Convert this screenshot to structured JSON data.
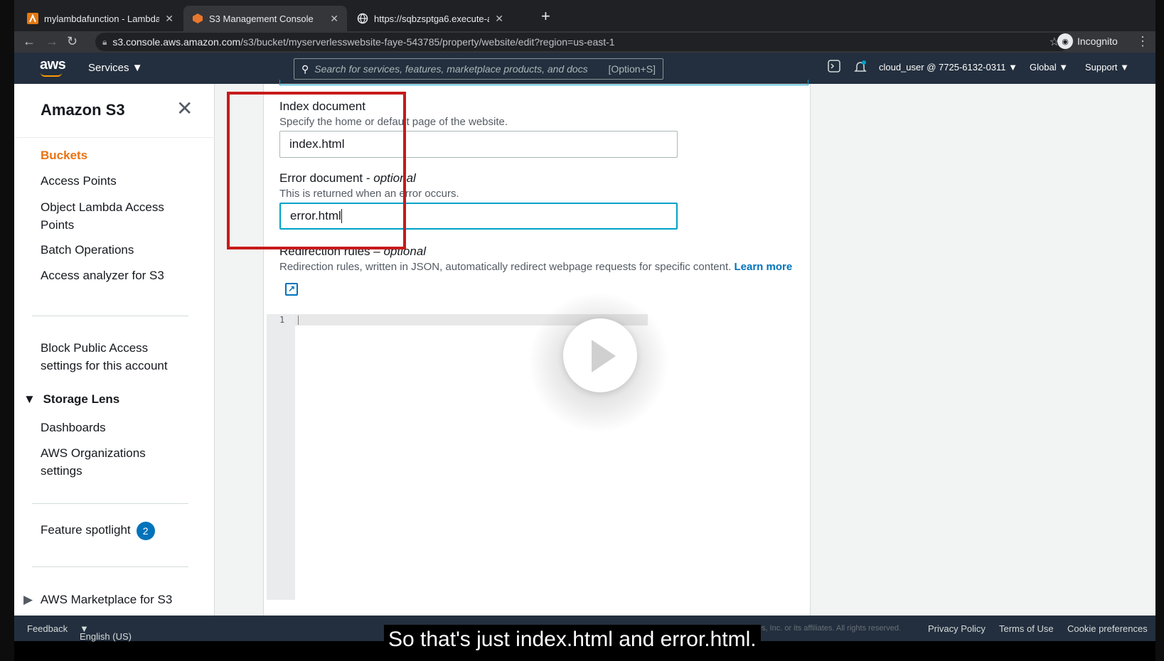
{
  "browser": {
    "tabs": [
      {
        "title": "mylambdafunction - Lambda",
        "icon": "lambda-icon",
        "active": false
      },
      {
        "title": "S3 Management Console",
        "icon": "s3-icon",
        "active": true
      },
      {
        "title": "https://sqbzsptga6.execute-a",
        "icon": "globe-icon",
        "active": false
      }
    ],
    "url_domain": "s3.console.aws.amazon.com",
    "url_path": "/s3/bucket/myserverlesswebsite-faye-543785/property/website/edit?region=us-east-1",
    "profile_label": "Incognito"
  },
  "aws_nav": {
    "logo": "aws",
    "services": "Services",
    "search_placeholder": "Search for services, features, marketplace products, and docs",
    "search_shortcut": "[Option+S]",
    "account": "cloud_user @ 7725-6132-0311",
    "region": "Global",
    "support": "Support"
  },
  "sidebar": {
    "title": "Amazon S3",
    "items": [
      {
        "label": "Buckets",
        "active": true
      },
      {
        "label": "Access Points"
      },
      {
        "label": "Object Lambda Access Points"
      },
      {
        "label": "Batch Operations"
      },
      {
        "label": "Access analyzer for S3"
      },
      {
        "label": "Block Public Access settings for this account"
      },
      {
        "label": "Dashboards"
      },
      {
        "label": "AWS Organizations settings"
      }
    ],
    "storage_lens": "Storage Lens",
    "feature_spotlight": "Feature spotlight",
    "feature_spotlight_count": "2",
    "marketplace": "AWS Marketplace for S3"
  },
  "form": {
    "index_label": "Index document",
    "index_desc": "Specify the home or default page of the website.",
    "index_value": "index.html",
    "error_label": "Error document - ",
    "error_optional": "optional",
    "error_desc": "This is returned when an error occurs.",
    "error_value": "error.html",
    "redirect_label": "Redirection rules – ",
    "redirect_optional": "optional",
    "redirect_desc": "Redirection rules, written in JSON, automatically redirect webpage requests for specific content.",
    "learn_more": "Learn more",
    "editor_line": "1"
  },
  "footer": {
    "feedback": "Feedback",
    "language": "English (US)",
    "copyright": "© 2008 - 2021, Amazon Web Services, Inc. or its affiliates. All rights reserved.",
    "privacy": "Privacy Policy",
    "terms": "Terms of Use",
    "cookies": "Cookie preferences"
  },
  "caption": "So that's just index.html and error.html.",
  "colors": {
    "aws_nav": "#232f3e",
    "accent_orange": "#ec7211",
    "link_blue": "#0073bb",
    "highlight_red": "#c71a1a"
  }
}
